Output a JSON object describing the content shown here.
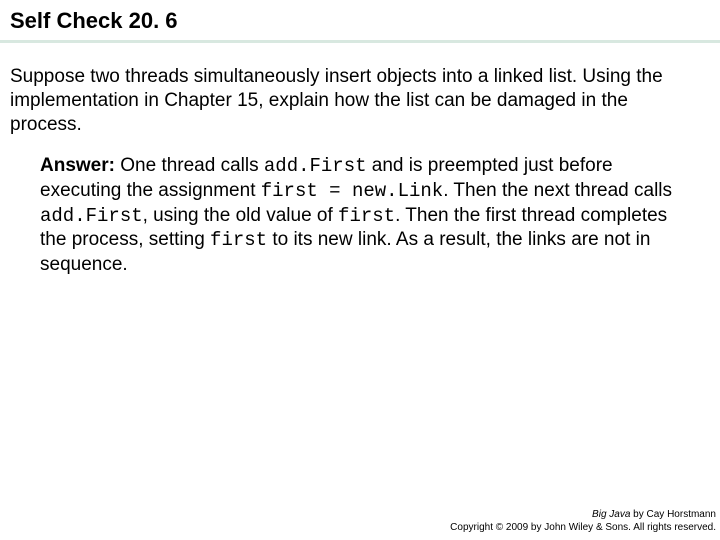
{
  "header": {
    "title": "Self Check 20. 6"
  },
  "question": {
    "text": "Suppose two threads simultaneously insert objects into a linked list. Using the implementation in Chapter 15, explain how the list can be damaged in the process."
  },
  "answer": {
    "label": "Answer:",
    "part1": " One thread calls ",
    "code1": "add.First",
    "part2": " and is preempted just before executing the assignment ",
    "code2": "first = new.Link",
    "part3": ". Then the next thread calls ",
    "code3": "add.First",
    "part4": ", using the old value of ",
    "code4": "first",
    "part5": ". Then the first thread completes the process, setting ",
    "code5": "first",
    "part6": " to its new link. As a result, the links are not in sequence."
  },
  "footer": {
    "book": "Big Java",
    "author": " by Cay Horstmann",
    "copyright": "Copyright © 2009 by John Wiley & Sons. All rights reserved."
  }
}
